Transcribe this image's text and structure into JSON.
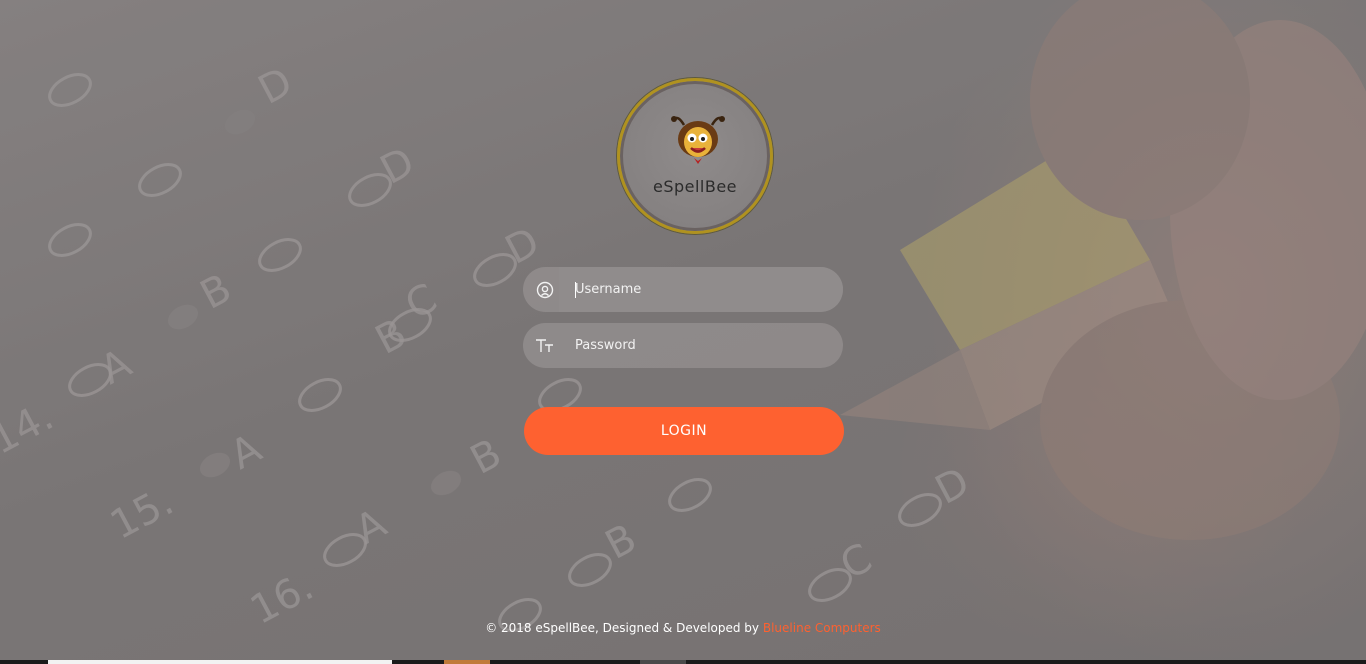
{
  "app": {
    "logo_text": "eSpellBee"
  },
  "form": {
    "username_placeholder": "Username",
    "password_placeholder": "Password",
    "login_label": "LOGIN"
  },
  "footer": {
    "copyright": "© 2018 eSpellBee, Designed & Developed by",
    "company_link": "Blueline Computers"
  },
  "icons": {
    "username": "user-circle-icon",
    "password": "text-size-icon",
    "logo": "bee-mascot-icon"
  },
  "colors": {
    "accent": "#fe6130",
    "logo_ring": "#b0921f"
  },
  "background": {
    "sheet_labels": [
      "14.",
      "15.",
      "16.",
      "A",
      "B",
      "C",
      "D"
    ]
  }
}
